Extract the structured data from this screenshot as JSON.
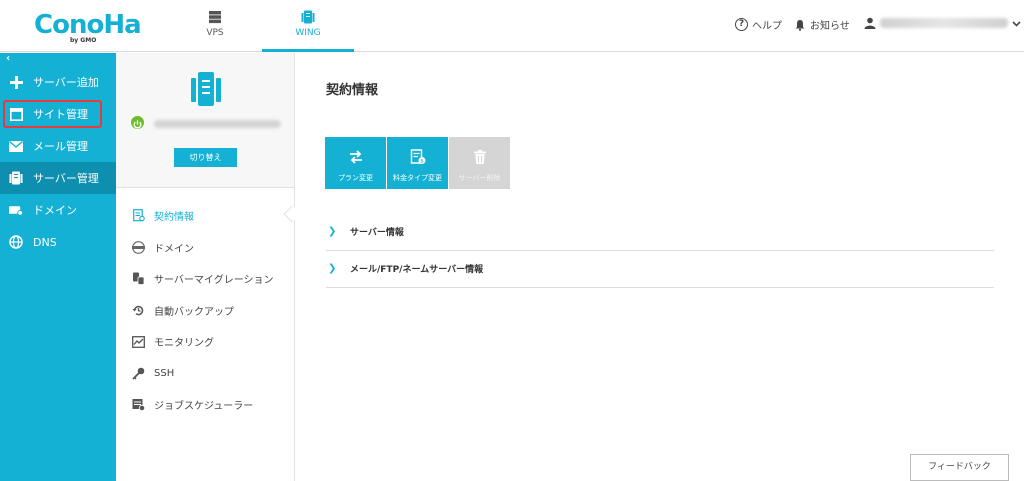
{
  "header": {
    "logo_text": "ConoHa",
    "logo_sub": "by GMO",
    "tabs": [
      {
        "label": "VPS",
        "icon": "server-stack-icon"
      },
      {
        "label": "WING",
        "icon": "wing-server-icon"
      }
    ],
    "help_label": "ヘルプ",
    "notice_label": "お知らせ"
  },
  "sidebar": {
    "collapse_glyph": "‹",
    "items": [
      {
        "label": "サーバー追加",
        "icon": "plus-icon"
      },
      {
        "label": "サイト管理",
        "icon": "window-icon"
      },
      {
        "label": "メール管理",
        "icon": "mail-icon"
      },
      {
        "label": "サーバー管理",
        "icon": "server-icon"
      },
      {
        "label": "ドメイン",
        "icon": "domain-icon"
      },
      {
        "label": "DNS",
        "icon": "globe-icon"
      }
    ]
  },
  "server_panel": {
    "switch_label": "切り替え"
  },
  "menu": {
    "items": [
      {
        "label": "契約情報",
        "icon": "contract-icon"
      },
      {
        "label": "ドメイン",
        "icon": "www-icon"
      },
      {
        "label": "サーバーマイグレーション",
        "icon": "migration-icon"
      },
      {
        "label": "自動バックアップ",
        "icon": "backup-icon"
      },
      {
        "label": "モニタリング",
        "icon": "monitoring-icon"
      },
      {
        "label": "SSH",
        "icon": "key-icon"
      },
      {
        "label": "ジョブスケジューラー",
        "icon": "scheduler-icon"
      }
    ]
  },
  "main": {
    "title": "契約情報",
    "actions": [
      {
        "label": "プラン変更",
        "icon": "swap-icon"
      },
      {
        "label": "料金タイプ変更",
        "icon": "billing-icon"
      },
      {
        "label": "サーバー削除",
        "icon": "trash-icon"
      }
    ],
    "sections": [
      {
        "label": "サーバー情報"
      },
      {
        "label": "メール/FTP/ネームサーバー情報"
      }
    ],
    "feedback_label": "フィードバック"
  },
  "colors": {
    "accent": "#14b1d4",
    "accent_dark": "#0f8fb0",
    "power_green": "#6cbf2a",
    "highlight_red": "#e53b3b"
  }
}
